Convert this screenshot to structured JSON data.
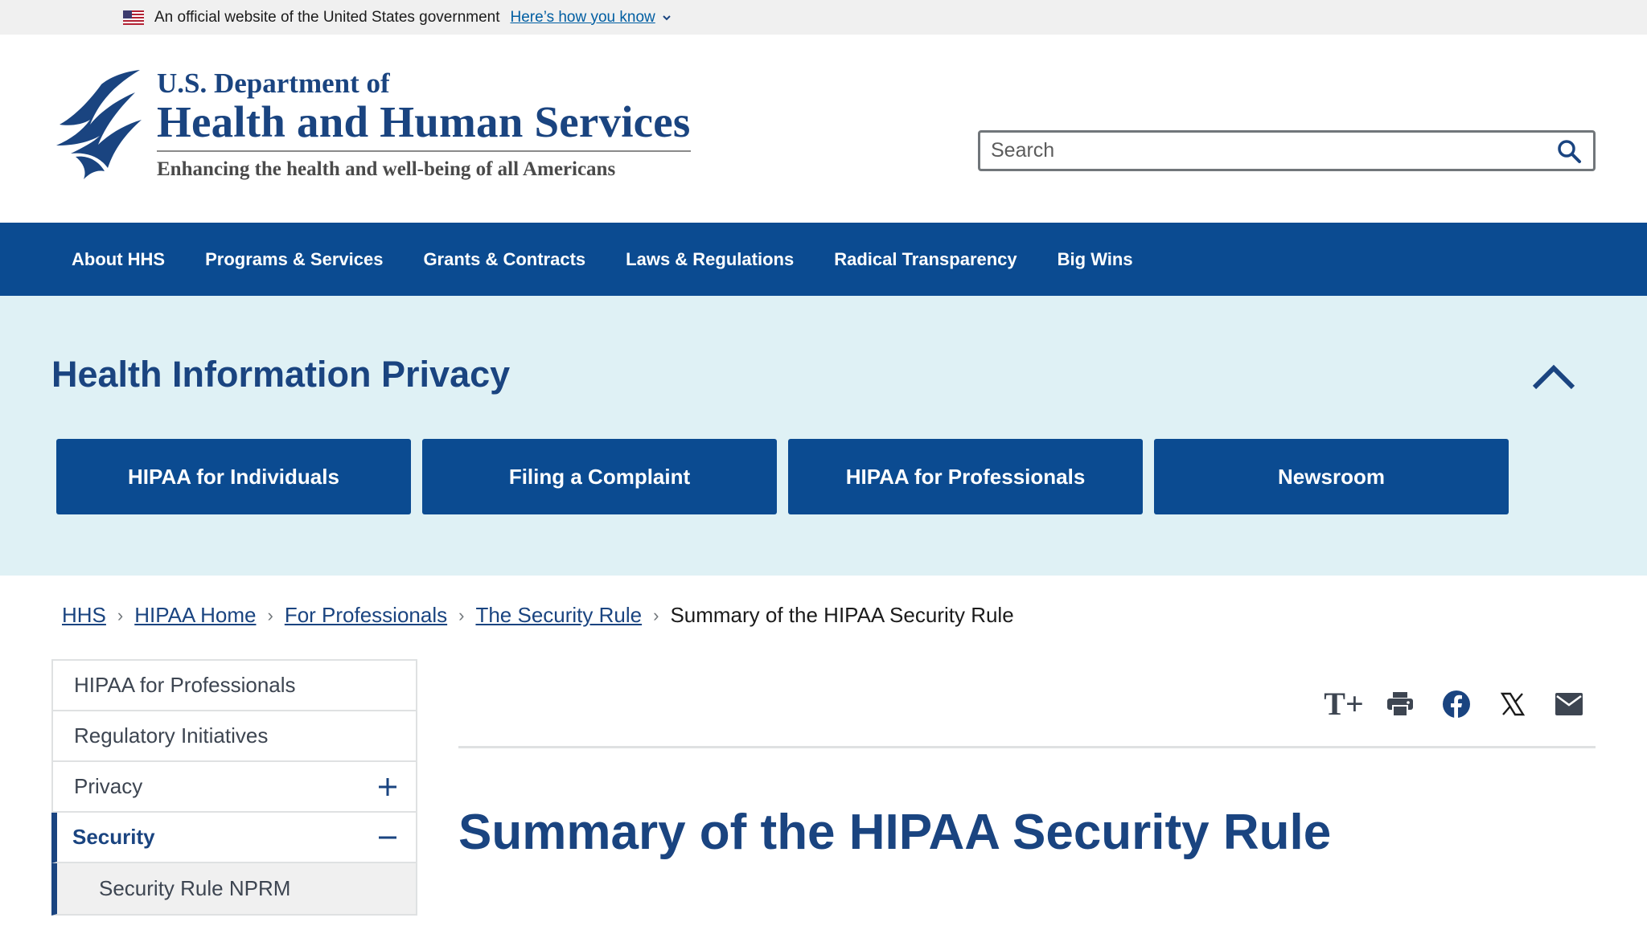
{
  "banner": {
    "text": "An official website of the United States government",
    "how_link": "Here’s how you know"
  },
  "header": {
    "dept": "U.S. Department of",
    "name": "Health and Human Services",
    "tagline": "Enhancing the health and well-being of all Americans",
    "search_placeholder": "Search"
  },
  "nav": {
    "items": [
      "About HHS",
      "Programs & Services",
      "Grants & Contracts",
      "Laws & Regulations",
      "Radical Transparency",
      "Big Wins"
    ]
  },
  "section": {
    "title": "Health Information Privacy",
    "tiles": [
      "HIPAA for Individuals",
      "Filing a Complaint",
      "HIPAA for Professionals",
      "Newsroom"
    ]
  },
  "breadcrumb": {
    "links": [
      "HHS",
      "HIPAA Home",
      "For Professionals",
      "The Security Rule"
    ],
    "current": "Summary of the HIPAA Security Rule"
  },
  "sidenav": {
    "items": [
      "HIPAA for Professionals",
      "Regulatory Initiatives",
      "Privacy",
      "Security"
    ],
    "sub_item": "Security Rule NPRM"
  },
  "share": {
    "text_size_icon": "T+"
  },
  "content": {
    "title": "Summary of the HIPAA Security Rule"
  },
  "colors": {
    "primary": "#0b4b91",
    "heading": "#1a4480",
    "band": "#dff1f5",
    "banner_bg": "#f0f0f0"
  },
  "icons": [
    "us-flag-icon",
    "chevron-down-icon",
    "hhs-eagle-logo",
    "search-icon",
    "chevron-up-icon",
    "plus-icon",
    "minus-icon",
    "text-size-icon",
    "print-icon",
    "facebook-icon",
    "x-icon",
    "email-icon"
  ]
}
